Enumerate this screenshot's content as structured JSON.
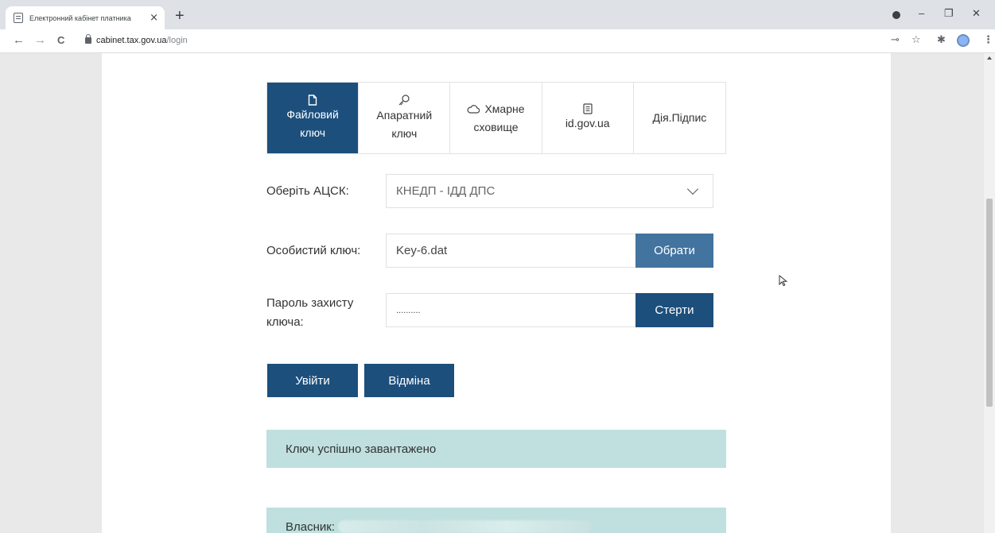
{
  "browser": {
    "tab_title": "Електронний кабінет платника",
    "tab_close": "×",
    "new_tab": "+",
    "url_host": "cabinet.tax.gov.ua",
    "url_path": "/login",
    "back": "←",
    "forward": "→",
    "reload": "C",
    "minimize": "–",
    "restore": "❐",
    "close": "✕"
  },
  "login_tabs": [
    {
      "line1": "Файловий",
      "line2": "ключ",
      "icon": "file-icon",
      "active": true
    },
    {
      "line1": "Апаратний",
      "line2": "ключ",
      "icon": "key-icon",
      "active": false
    },
    {
      "line1": "Хмарне",
      "line2": "сховище",
      "icon": "cloud-icon",
      "active": false
    },
    {
      "line1": "id.gov.ua",
      "icon": "book-icon",
      "active": false
    },
    {
      "line1": "Дія.Підпис",
      "active": false
    }
  ],
  "form": {
    "acsk_label": "Оберіть АЦСК:",
    "acsk_value": "КНЕДП - ІДД ДПС",
    "key_label": "Особистий ключ:",
    "key_value": "Key-6.dat",
    "choose_button": "Обрати",
    "password_label_line1": "Пароль захисту",
    "password_label_line2": "ключа:",
    "password_value": "..........",
    "clear_button": "Стерти",
    "login_button": "Увійти",
    "cancel_button": "Відміна"
  },
  "messages": {
    "success": "Ключ успішно завантажено",
    "owner_label": "Власник:"
  },
  "colors": {
    "primary": "#1c4f7c",
    "choose_button": "#43739f",
    "alert": "#bfe0de"
  }
}
